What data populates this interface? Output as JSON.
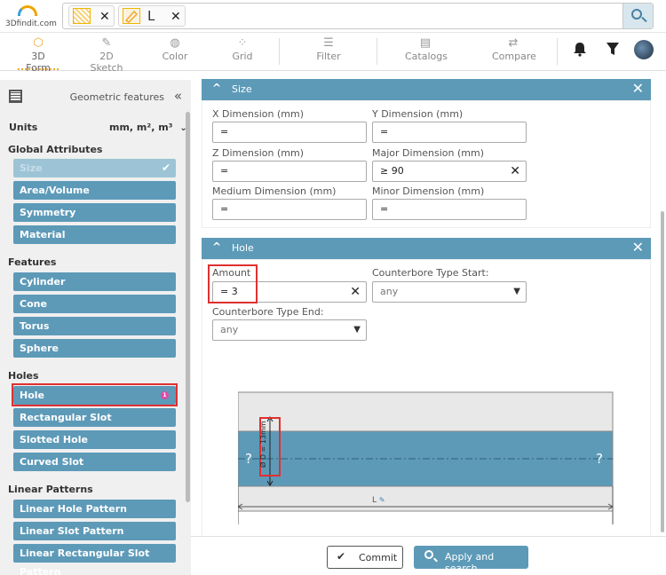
{
  "header": {
    "logo_text": "3Dfindit.com",
    "search": {
      "chip2_text": "L"
    }
  },
  "toolbar": {
    "items": [
      {
        "label": "3D Form",
        "icon": "cube-icon"
      },
      {
        "label": "2D Sketch",
        "icon": "pencil-icon"
      },
      {
        "label": "Color",
        "icon": "palette-icon"
      },
      {
        "label": "Grid",
        "icon": "grid-icon"
      },
      {
        "label": "Filter",
        "icon": "sliders-icon"
      },
      {
        "label": "Catalogs",
        "icon": "catalog-icon"
      },
      {
        "label": "Compare",
        "icon": "compare-icon"
      }
    ],
    "active": "3D Form",
    "accent_color": "#f0a830"
  },
  "sidebar": {
    "title": "Geometric features",
    "units_label": "Units",
    "units_value": "mm, m², m³",
    "sections": [
      {
        "label": "Global Attributes",
        "items": [
          "Size",
          "Area/Volume",
          "Symmetry",
          "Material"
        ]
      },
      {
        "label": "Features",
        "items": [
          "Cylinder",
          "Cone",
          "Torus",
          "Sphere"
        ]
      },
      {
        "label": "Holes",
        "items": [
          "Hole",
          "Rectangular Slot",
          "Slotted Hole",
          "Curved Slot"
        ]
      },
      {
        "label": "Linear Patterns",
        "items": [
          "Linear Hole Pattern",
          "Linear Slot Pattern",
          "Linear Rectangular Slot Pattern"
        ]
      }
    ],
    "hole_badge": "1",
    "button_color": "#5d9ab8"
  },
  "size_panel": {
    "title": "Size",
    "fields": [
      {
        "label": "X Dimension (mm)",
        "value": "="
      },
      {
        "label": "Y Dimension (mm)",
        "value": "="
      },
      {
        "label": "Z Dimension (mm)",
        "value": "="
      },
      {
        "label": "Major Dimension (mm)",
        "value": "≥  90"
      },
      {
        "label": "Medium Dimension (mm)",
        "value": "="
      },
      {
        "label": "Minor Dimension (mm)",
        "value": "="
      }
    ]
  },
  "hole_panel": {
    "title": "Hole",
    "amount_label": "Amount",
    "amount_value": "=  3",
    "cb_start_label": "Counterbore Type Start:",
    "cb_start_value": "any",
    "cb_end_label": "Counterbore Type End:",
    "cb_end_value": "any",
    "drawing": {
      "diameter_label": "Ø D = 13mm",
      "length_label": "L",
      "unknown_left": "?",
      "unknown_right": "?"
    }
  },
  "footer": {
    "commit_label": "Commit",
    "apply_label": "Apply and search"
  }
}
